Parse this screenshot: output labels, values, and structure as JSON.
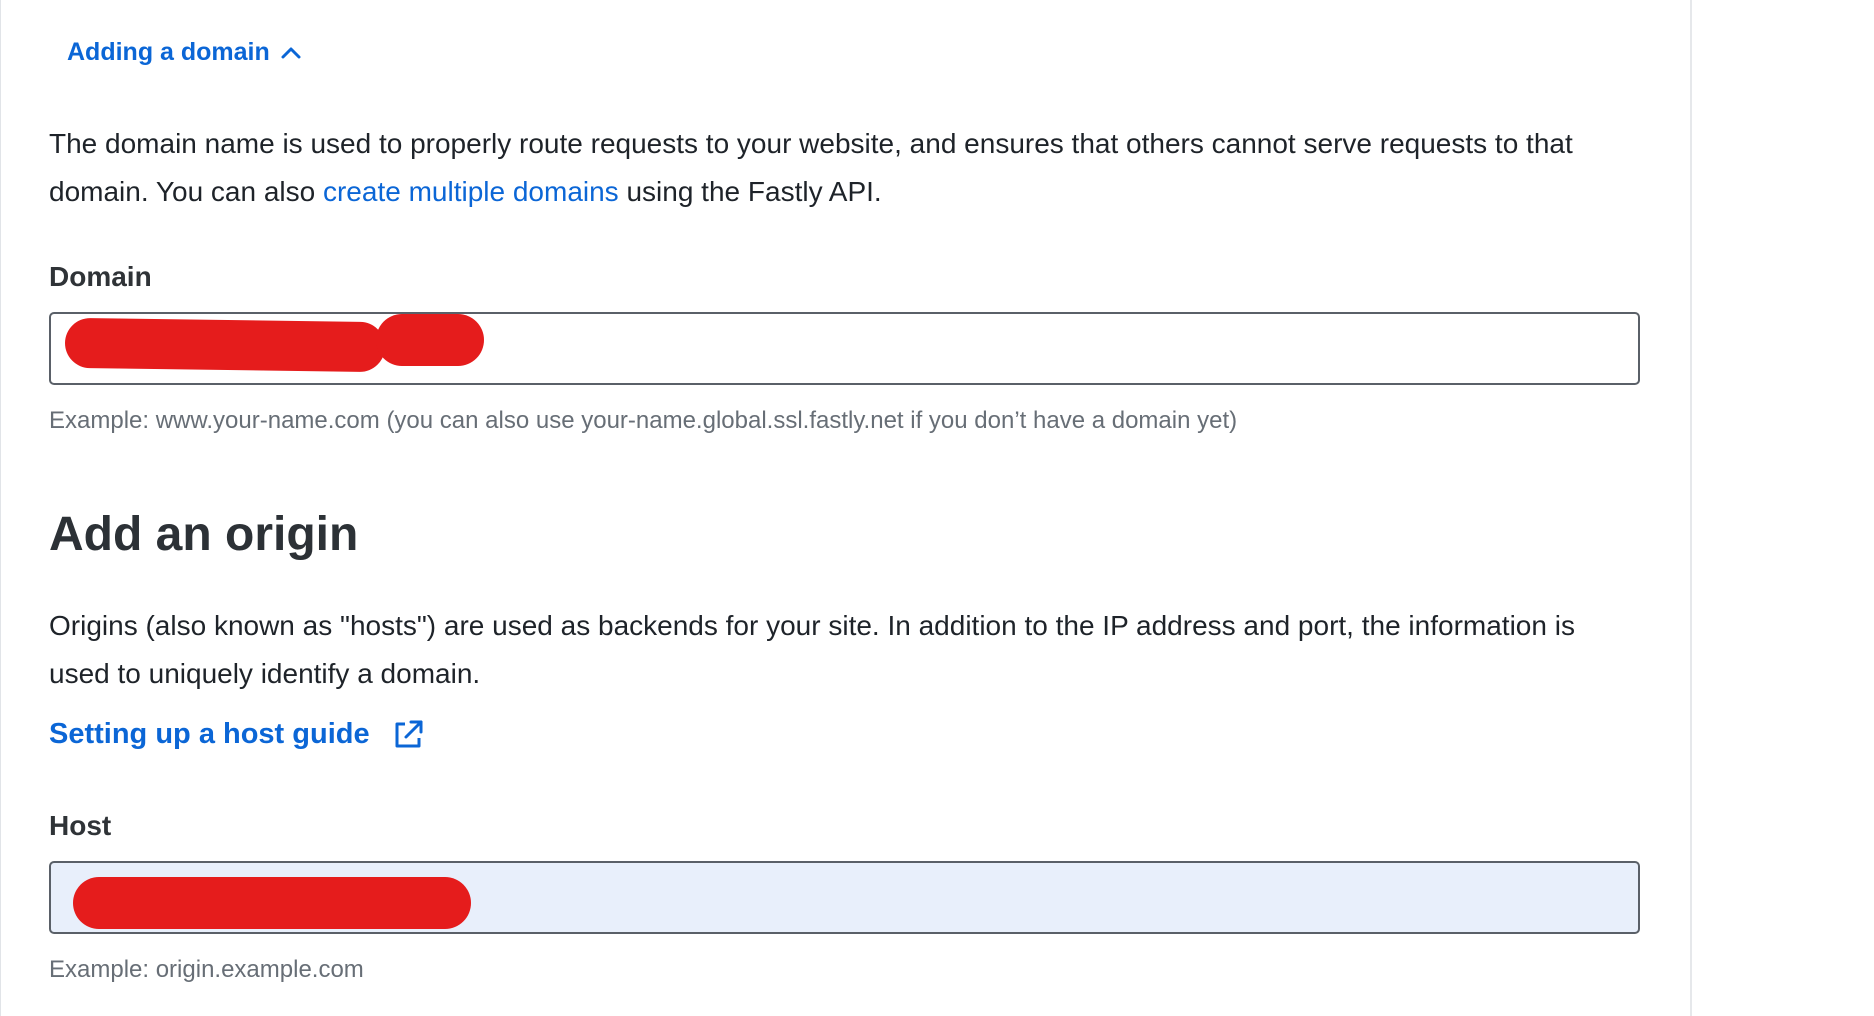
{
  "toggle": {
    "label": "Adding a domain",
    "icon": "chevron-up-icon"
  },
  "domain_section": {
    "intro_before_link": "The domain name is used to properly route requests to your website, and ensures that others cannot serve requests to that domain. You can also ",
    "intro_link": "create multiple domains",
    "intro_after_link": " using the Fastly API.",
    "field_label": "Domain",
    "field_value": "",
    "field_hint": "Example: www.your-name.com (you can also use your-name.global.ssl.fastly.net if you don’t have a domain yet)"
  },
  "origin_section": {
    "heading": "Add an origin",
    "intro": "Origins (also known as \"hosts\") are used as backends for your site. In addition to the IP address and port, the information is used to uniquely identify a domain.",
    "guide_link": "Setting up a host guide",
    "guide_icon": "external-link-icon",
    "field_label": "Host",
    "field_value": "",
    "field_hint": "Example: origin.example.com"
  },
  "colors": {
    "link": "#0b66d6",
    "redaction": "#e51c1c",
    "autofill_bg": "#e8effb",
    "input_border": "#5a6068"
  }
}
